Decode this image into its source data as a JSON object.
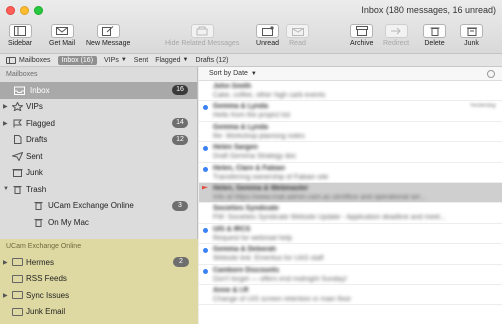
{
  "window": {
    "title": "Inbox (180 messages, 16 unread)"
  },
  "toolbar": {
    "sidebar": "Sidebar",
    "get_mail": "Get Mail",
    "new_message": "New Message",
    "hide_related": "Hide Related Messages",
    "unread": "Unread",
    "read": "Read",
    "archive": "Archive",
    "redirect": "Redirect",
    "delete": "Delete",
    "junk": "Junk"
  },
  "favorites": {
    "mailboxes": "Mailboxes",
    "inbox": "Inbox (16)",
    "vips": "VIPs",
    "sent": "Sent",
    "flagged": "Flagged",
    "drafts": "Drafts (12)"
  },
  "sidebar": {
    "mailboxes_heading": "Mailboxes",
    "items": [
      {
        "label": "Inbox",
        "badge": "16"
      },
      {
        "label": "VIPs"
      },
      {
        "label": "Flagged",
        "badge": "14"
      },
      {
        "label": "Drafts",
        "badge": "12"
      },
      {
        "label": "Sent"
      },
      {
        "label": "Junk"
      },
      {
        "label": "Trash"
      },
      {
        "label": "UCam Exchange Online",
        "badge": "3"
      },
      {
        "label": "On My Mac"
      }
    ],
    "account_heading": "UCam Exchange Online",
    "account_items": [
      {
        "label": "Hermes",
        "badge": "2"
      },
      {
        "label": "RSS Feeds"
      },
      {
        "label": "Sync Issues"
      },
      {
        "label": "Junk Email"
      }
    ]
  },
  "list": {
    "sort": "Sort by Date",
    "rows": [
      {
        "l1": "John Smith",
        "l2": "Cake, coffee, other high carb events",
        "date": ""
      },
      {
        "l1": "Gemma & Lynda",
        "l2": "Hello from the project list",
        "date": "Yesterday"
      },
      {
        "l1": "Gemma & Lynda",
        "l2": "Re: Workshop planning notes",
        "date": ""
      },
      {
        "l1": "Helen Sargen",
        "l2": "Draft Gemma Strategy doc",
        "date": ""
      },
      {
        "l1": "Helen, Clare & Fabian",
        "l2": "Transferring ownership of Fabian site",
        "date": ""
      },
      {
        "l1": "Helen, Gemma & Webmaster",
        "l2": "Info at https://www.mail.admin.cam.ac.uk/office and operational ser...",
        "date": ""
      },
      {
        "l1": "Societies Syndicate",
        "l2": "FW: Societies Syndicate Website Update - Application deadline and meet...",
        "date": ""
      },
      {
        "l1": "UIS & IRCS",
        "l2": "Request for webmail help",
        "date": ""
      },
      {
        "l1": "Gemma & Deborah",
        "l2": "Website link: Emeritus for UAS staff",
        "date": ""
      },
      {
        "l1": "Cambore Discounts",
        "l2": "Don't forget — offers end midnight Sunday!",
        "date": ""
      },
      {
        "l1": "Anne & I.R",
        "l2": "Change of UIS screen retention in main floor",
        "date": ""
      }
    ]
  },
  "colors": {
    "sidebar_account_bg": "#ded9a2",
    "unread_dot": "#3b82f6",
    "flag": "#e34c3b"
  }
}
